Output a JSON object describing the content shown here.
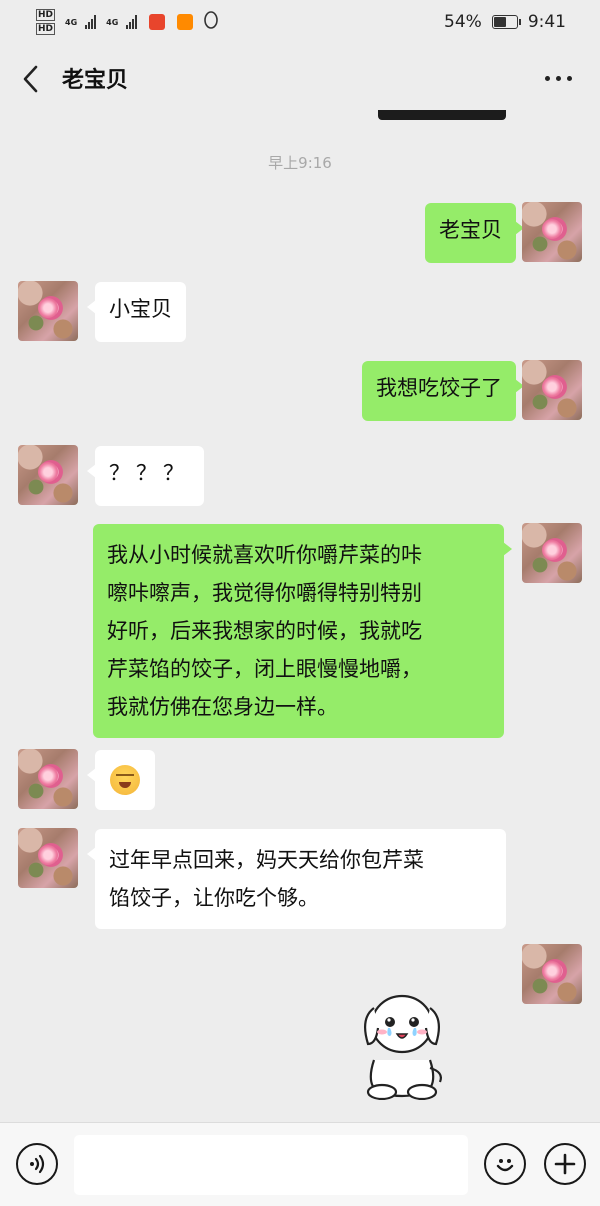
{
  "status_bar": {
    "battery": "54%",
    "time": "9:41",
    "network_1": "4G",
    "network_2": "4G",
    "hd": "HD"
  },
  "header": {
    "title": "老宝贝"
  },
  "timestamp": "早上9:16",
  "messages": [
    {
      "sender": "me",
      "text": "老宝贝"
    },
    {
      "sender": "them",
      "text": "小宝贝"
    },
    {
      "sender": "me",
      "text": "我想吃饺子了"
    },
    {
      "sender": "them",
      "text": "？？？"
    },
    {
      "sender": "me",
      "lines": [
        "我从小时候就喜欢听你嚼芹菜的咔",
        "嚓咔嚓声，我觉得你嚼得特别特别",
        "好听，后来我想家的时候，我就吃",
        "芹菜馅的饺子，闭上眼慢慢地嚼，",
        "我就仿佛在您身边一样。"
      ]
    },
    {
      "sender": "them",
      "emoji": "crying-laughing-face"
    },
    {
      "sender": "them",
      "lines": [
        "过年早点回来，妈天天给你包芹菜",
        "馅饺子，让你吃个够。"
      ]
    },
    {
      "sender": "me",
      "sticker": "crying-white-puppy"
    }
  ],
  "input": {
    "placeholder": ""
  },
  "colors": {
    "background": "#ededed",
    "my_bubble": "#95ec69",
    "their_bubble": "#ffffff"
  },
  "icons": [
    "back-arrow-icon",
    "more-dots-icon",
    "voice-icon",
    "emoji-icon",
    "plus-icon"
  ]
}
